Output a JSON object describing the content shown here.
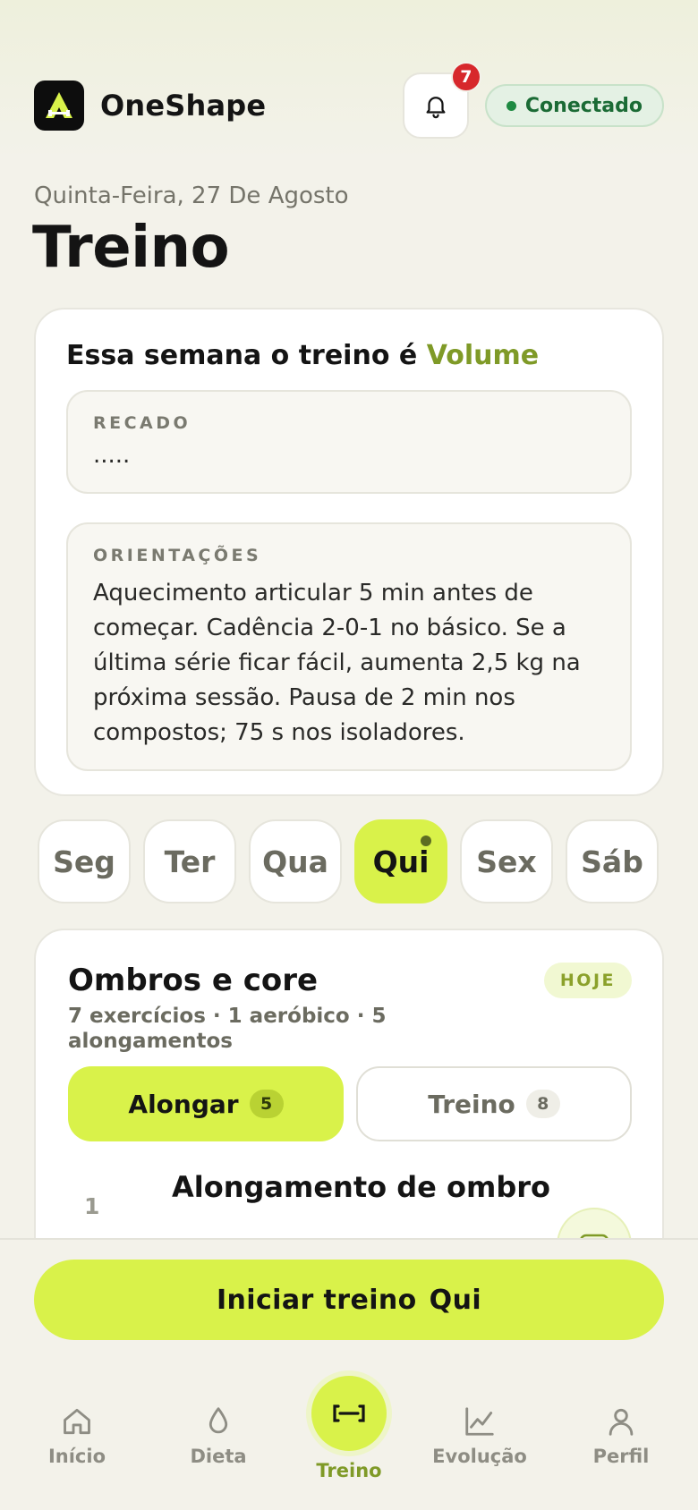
{
  "header": {
    "app_title": "OneShape",
    "notification_count": "7",
    "status": "Conectado"
  },
  "date_line": "Quinta-Feira, 27 De Agosto",
  "page_title": "Treino",
  "week_card": {
    "heading_prefix": "Essa semana o treino é",
    "heading_accent": "Volume",
    "recado_label": "RECADO",
    "recado_text": ".....",
    "orientacoes_label": "ORIENTAÇÕES",
    "orientacoes_text": "Aquecimento articular 5 min antes de começar. Cadência 2-0-1 no básico. Se a última série ficar fácil, aumenta 2,5 kg na próxima sessão. Pausa de 2 min nos compostos; 75 s nos isoladores."
  },
  "days": [
    "Seg",
    "Ter",
    "Qua",
    "Qui",
    "Sex",
    "Sáb"
  ],
  "selected_day": "Qui",
  "workout": {
    "title": "Ombros e core",
    "today_badge": "HOJE",
    "subtitle": "7 exercícios · 1 aeróbico · 5 alongamentos",
    "seg_stretch_label": "Alongar",
    "seg_stretch_count": "5",
    "seg_workout_label": "Treino",
    "seg_workout_count": "8",
    "first_exercise_number": "1",
    "first_exercise_name": "Alongamento de ombro"
  },
  "start_button": {
    "label": "Iniciar treino",
    "day": "Qui"
  },
  "tabbar": {
    "home": "Início",
    "diet": "Dieta",
    "workout": "Treino",
    "progress": "Evolução",
    "profile": "Perfil"
  },
  "colors": {
    "accent_lime": "#d9f24a",
    "accent_olive": "#7f9a27",
    "status_green": "#1b6b35",
    "badge_red": "#d7282c"
  }
}
